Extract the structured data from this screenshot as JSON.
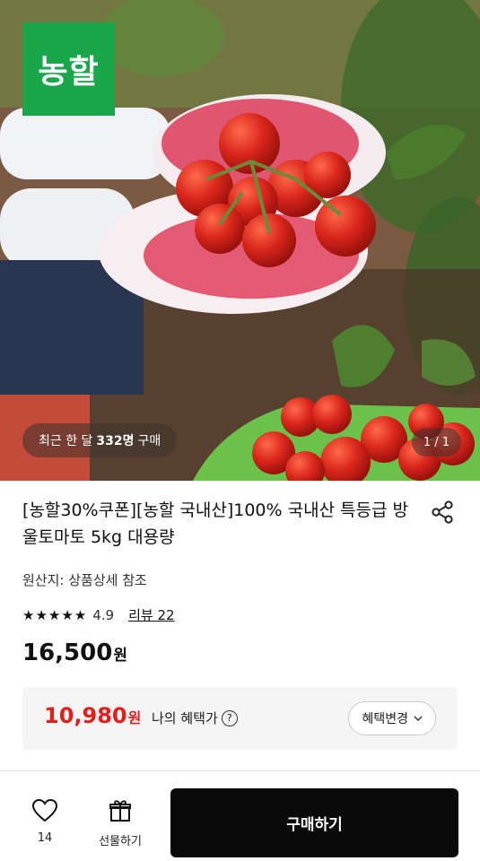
{
  "hero": {
    "brand_logo_text": "농할",
    "recent_prefix": "최근 한 달",
    "recent_count": "332명",
    "recent_suffix": "구매",
    "page_indicator": "1 / 1",
    "colors": {
      "brand_green": "#1aa64a",
      "tomato": "#d9261c"
    }
  },
  "product": {
    "title": "[농할30%쿠폰][농할 국내산]100% 국내산 특등급 방울토마토 5kg 대용량",
    "origin": "원산지: 상품상세 참조",
    "rating": {
      "stars": "★★★★★",
      "score": "4.9",
      "review_link": "리뷰 22"
    },
    "price": {
      "amount": "16,500",
      "unit": "원"
    }
  },
  "benefit": {
    "price": "10,980",
    "unit": "원",
    "label": "나의 혜택가",
    "help_icon": "?",
    "change_button": "혜택변경",
    "accent_color": "#e0201d"
  },
  "bottom_bar": {
    "like_count": "14",
    "gift_label": "선물하기",
    "buy_label": "구매하기"
  }
}
